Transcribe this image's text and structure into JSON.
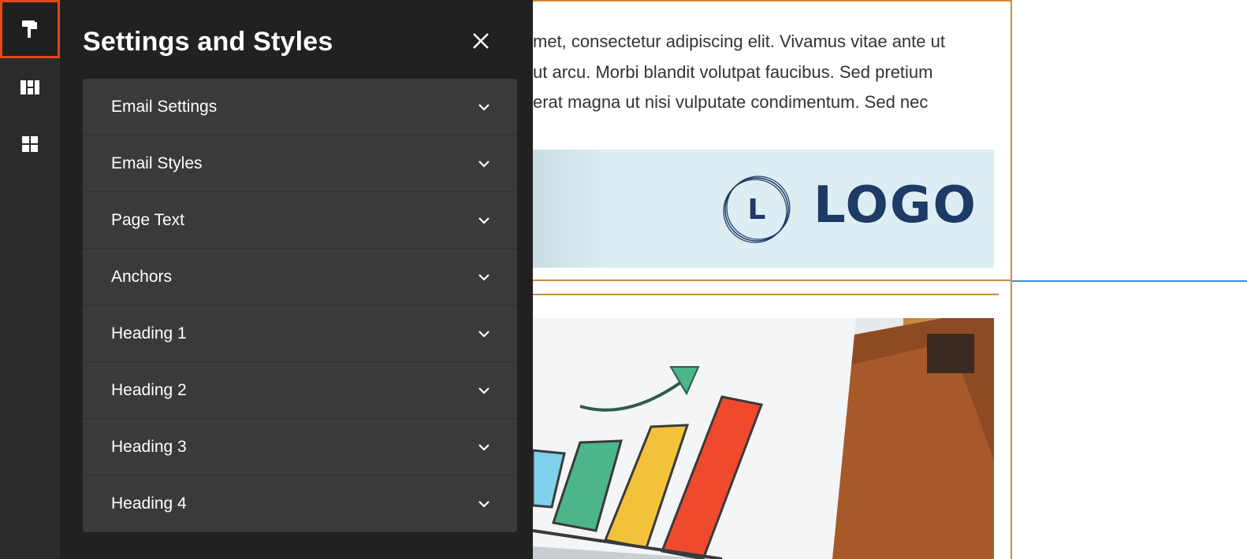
{
  "rail": {
    "items": [
      {
        "icon": "paint-roller-icon",
        "active": true
      },
      {
        "icon": "layout-blocks-icon",
        "active": false
      },
      {
        "icon": "grid-icon",
        "active": false
      }
    ]
  },
  "panel": {
    "title": "Settings and Styles",
    "sections": [
      {
        "label": "Email Settings"
      },
      {
        "label": "Email Styles"
      },
      {
        "label": "Page Text"
      },
      {
        "label": "Anchors"
      },
      {
        "label": "Heading 1"
      },
      {
        "label": "Heading 2"
      },
      {
        "label": "Heading 3"
      },
      {
        "label": "Heading 4"
      }
    ]
  },
  "canvas": {
    "body_lines": [
      "met, consectetur adipiscing elit. Vivamus vitae ante ut",
      "ut arcu. Morbi blandit volutpat faucibus. Sed pretium",
      "erat magna ut nisi vulputate condimentum. Sed nec"
    ],
    "logo_letter": "L",
    "logo_word": "LOGO"
  },
  "colors": {
    "accent_selected": "#e0481c",
    "frame_orange": "#d08a3b",
    "guide_blue": "#3b8ed6",
    "logo_navy": "#1e3a66"
  }
}
